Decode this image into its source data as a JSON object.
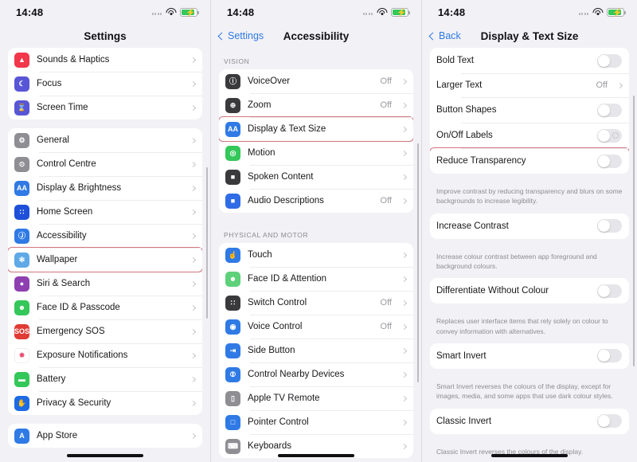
{
  "status": {
    "time": "14:48",
    "wifi_icon": "wifi-icon",
    "battery_icon": "battery-charging-icon",
    "signal_icon": "signal-dots-icon"
  },
  "panels": [
    {
      "nav": {
        "title": "Settings",
        "back_label": ""
      },
      "groups": [
        {
          "header": "",
          "rows": [
            {
              "label": "Sounds & Haptics",
              "value": "",
              "icon": "sounds-haptics-icon",
              "color": "#f2374a",
              "glyph": "▲",
              "type": "link"
            },
            {
              "label": "Focus",
              "value": "",
              "icon": "focus-icon",
              "color": "#5856d6",
              "glyph": "☾",
              "type": "link"
            },
            {
              "label": "Screen Time",
              "value": "",
              "icon": "screen-time-icon",
              "color": "#5856d6",
              "glyph": "⌛",
              "type": "link"
            }
          ]
        },
        {
          "header": "",
          "rows": [
            {
              "label": "General",
              "value": "",
              "icon": "general-gear-icon",
              "color": "#8e8e93",
              "glyph": "⚙",
              "type": "link"
            },
            {
              "label": "Control Centre",
              "value": "",
              "icon": "control-centre-icon",
              "color": "#8e8e93",
              "glyph": "⊙",
              "type": "link"
            },
            {
              "label": "Display & Brightness",
              "value": "",
              "icon": "display-brightness-icon",
              "color": "#2f7ae5",
              "glyph": "AA",
              "type": "link"
            },
            {
              "label": "Home Screen",
              "value": "",
              "icon": "home-screen-icon",
              "color": "#1d4fd8",
              "glyph": "∷",
              "type": "link"
            },
            {
              "label": "Accessibility",
              "value": "",
              "icon": "accessibility-icon",
              "color": "#2f7ae5",
              "glyph": "Ⓙ",
              "type": "link"
            },
            {
              "label": "Wallpaper",
              "value": "",
              "icon": "wallpaper-icon",
              "color": "#5ea9e6",
              "glyph": "✻",
              "type": "link",
              "highlight": true
            },
            {
              "label": "Siri & Search",
              "value": "",
              "icon": "siri-search-icon",
              "color": "#8e3fb0",
              "glyph": "●",
              "type": "link"
            },
            {
              "label": "Face ID & Passcode",
              "value": "",
              "icon": "face-id-icon",
              "color": "#34c759",
              "glyph": "☻",
              "type": "link"
            },
            {
              "label": "Emergency SOS",
              "value": "",
              "icon": "emergency-sos-icon",
              "color": "#e03b34",
              "glyph": "SOS",
              "type": "link"
            },
            {
              "label": "Exposure Notifications",
              "value": "",
              "icon": "exposure-notifications-icon",
              "color": "#ffffff",
              "glyph": "✵",
              "type": "link"
            },
            {
              "label": "Battery",
              "value": "",
              "icon": "battery-icon",
              "color": "#34c759",
              "glyph": "▬",
              "type": "link"
            },
            {
              "label": "Privacy & Security",
              "value": "",
              "icon": "privacy-security-icon",
              "color": "#1d6ae5",
              "glyph": "✋",
              "type": "link"
            }
          ]
        },
        {
          "header": "",
          "rows": [
            {
              "label": "App Store",
              "value": "",
              "icon": "app-store-icon",
              "color": "#2f7ae5",
              "glyph": "A",
              "type": "link"
            }
          ]
        }
      ]
    },
    {
      "nav": {
        "title": "Accessibility",
        "back_label": "Settings"
      },
      "groups": [
        {
          "header": "VISION",
          "rows": [
            {
              "label": "VoiceOver",
              "value": "Off",
              "icon": "voiceover-icon",
              "color": "#3a3a3c",
              "glyph": "ⓘ",
              "type": "link"
            },
            {
              "label": "Zoom",
              "value": "Off",
              "icon": "zoom-icon",
              "color": "#3a3a3c",
              "glyph": "⊕",
              "type": "link"
            },
            {
              "label": "Display & Text Size",
              "value": "",
              "icon": "display-text-size-icon",
              "color": "#2f7ae5",
              "glyph": "AA",
              "type": "link",
              "highlight": true
            },
            {
              "label": "Motion",
              "value": "",
              "icon": "motion-icon",
              "color": "#34c759",
              "glyph": "◎",
              "type": "link"
            },
            {
              "label": "Spoken Content",
              "value": "",
              "icon": "spoken-content-icon",
              "color": "#3a3a3c",
              "glyph": "■",
              "type": "link"
            },
            {
              "label": "Audio Descriptions",
              "value": "Off",
              "icon": "audio-descriptions-icon",
              "color": "#2f6ce5",
              "glyph": "■",
              "type": "link"
            }
          ]
        },
        {
          "header": "PHYSICAL AND MOTOR",
          "rows": [
            {
              "label": "Touch",
              "value": "",
              "icon": "touch-icon",
              "color": "#2f7ae5",
              "glyph": "☝",
              "type": "link"
            },
            {
              "label": "Face ID & Attention",
              "value": "",
              "icon": "face-id-attention-icon",
              "color": "#5ed17a",
              "glyph": "☻",
              "type": "link"
            },
            {
              "label": "Switch Control",
              "value": "Off",
              "icon": "switch-control-icon",
              "color": "#3a3a3c",
              "glyph": "∷",
              "type": "link"
            },
            {
              "label": "Voice Control",
              "value": "Off",
              "icon": "voice-control-icon",
              "color": "#2f7ae5",
              "glyph": "◉",
              "type": "link"
            },
            {
              "label": "Side Button",
              "value": "",
              "icon": "side-button-icon",
              "color": "#2f7ae5",
              "glyph": "⇥",
              "type": "link"
            },
            {
              "label": "Control Nearby Devices",
              "value": "",
              "icon": "control-nearby-devices-icon",
              "color": "#2f7ae5",
              "glyph": "⦷",
              "type": "link"
            },
            {
              "label": "Apple TV Remote",
              "value": "",
              "icon": "apple-tv-remote-icon",
              "color": "#8e8e93",
              "glyph": "▯",
              "type": "link"
            },
            {
              "label": "Pointer Control",
              "value": "",
              "icon": "pointer-control-icon",
              "color": "#2f7ae5",
              "glyph": "□",
              "type": "link"
            },
            {
              "label": "Keyboards",
              "value": "",
              "icon": "keyboards-icon",
              "color": "#8e8e93",
              "glyph": "⌨",
              "type": "link"
            }
          ]
        }
      ]
    },
    {
      "nav": {
        "title": "Display & Text Size",
        "back_label": "Back"
      },
      "groups": [
        {
          "header": "",
          "rows": [
            {
              "label": "Bold Text",
              "value": "",
              "type": "toggle",
              "on": false
            },
            {
              "label": "Larger Text",
              "value": "Off",
              "type": "link"
            },
            {
              "label": "Button Shapes",
              "value": "",
              "type": "toggle",
              "on": false
            },
            {
              "label": "On/Off Labels",
              "value": "",
              "type": "toggle-labels",
              "on": false
            },
            {
              "label": "Reduce Transparency",
              "value": "",
              "type": "toggle",
              "on": false,
              "highlight": true
            }
          ],
          "footnote": "Improve contrast by reducing transparency and blurs on some backgrounds to increase legibility."
        },
        {
          "header": "",
          "rows": [
            {
              "label": "Increase Contrast",
              "value": "",
              "type": "toggle",
              "on": false
            }
          ],
          "footnote": "Increase colour contrast between app foreground and background colours."
        },
        {
          "header": "",
          "rows": [
            {
              "label": "Differentiate Without Colour",
              "value": "",
              "type": "toggle",
              "on": false
            }
          ],
          "footnote": "Replaces user interface items that rely solely on colour to convey information with alternatives."
        },
        {
          "header": "",
          "rows": [
            {
              "label": "Smart Invert",
              "value": "",
              "type": "toggle",
              "on": false
            }
          ],
          "footnote": "Smart Invert reverses the colours of the display, except for images, media, and some apps that use dark colour styles."
        },
        {
          "header": "",
          "rows": [
            {
              "label": "Classic Invert",
              "value": "",
              "type": "toggle",
              "on": false
            }
          ],
          "footnote": "Classic Invert reverses the colours of the display."
        }
      ]
    }
  ],
  "highlight_color": "#d1757f",
  "accent_color": "#2f7ae5"
}
